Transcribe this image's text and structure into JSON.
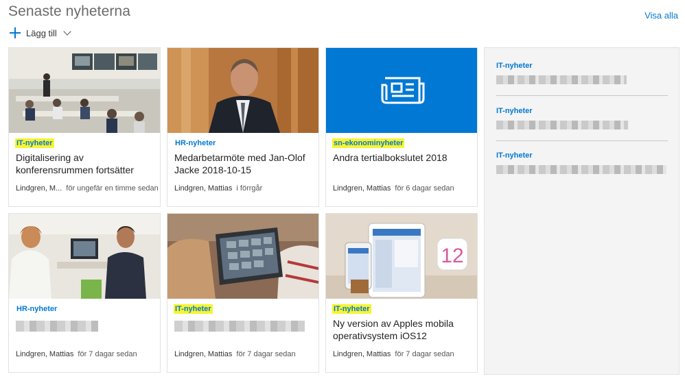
{
  "header": {
    "title": "Senaste nyheterna",
    "see_all": "Visa alla",
    "add_label": "Lägg till"
  },
  "cards": [
    {
      "category": "IT-nyheter",
      "highlighted": true,
      "headline": "Digitalisering av konferensrummen fortsätter",
      "author": "Lindgren, M...",
      "time": "för ungefär en timme sedan",
      "image": "conference-room-photo"
    },
    {
      "category": "HR-nyheter",
      "highlighted": false,
      "headline": "Medarbetarmöte med Jan-Olof Jacke 2018-10-15",
      "author": "Lindgren, Mattias",
      "time": "i förrgår",
      "image": "portrait-photo"
    },
    {
      "category": "sn-ekonominyheter",
      "highlighted": true,
      "headline": "Andra tertialbokslutet 2018",
      "author": "Lindgren, Mattias",
      "time": "för 6 dagar sedan",
      "image": "news-icon-tile"
    },
    {
      "category": "HR-nyheter",
      "highlighted": false,
      "headline": "",
      "author": "Lindgren, Mattias",
      "time": "för 7 dagar sedan",
      "image": "office-meeting-photo"
    },
    {
      "category": "IT-nyheter",
      "highlighted": true,
      "headline": "",
      "author": "Lindgren, Mattias",
      "time": "för 7 dagar sedan",
      "image": "laptop-photo"
    },
    {
      "category": "IT-nyheter",
      "highlighted": true,
      "headline": "Ny version av Apples mobila operativsystem iOS12",
      "author": "Lindgren, Mattias",
      "time": "för 7 dagar sedan",
      "image": "ios12-devices-photo"
    }
  ],
  "sidebar": {
    "items": [
      {
        "category": "IT-nyheter"
      },
      {
        "category": "IT-nyheter"
      },
      {
        "category": "IT-nyheter"
      }
    ]
  },
  "colors": {
    "accent": "#0078d4",
    "highlight": "#f7f431",
    "tile_blue": "#0078d4"
  }
}
